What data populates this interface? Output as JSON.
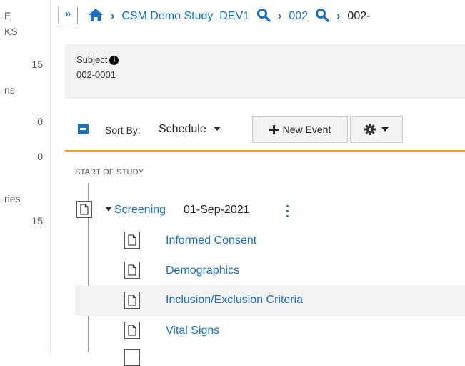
{
  "sidebar": {
    "items": [
      {
        "label": "E"
      },
      {
        "label": "KS"
      },
      {
        "label": "15"
      },
      {
        "label": "ns"
      },
      {
        "label": "0"
      },
      {
        "label": "0"
      },
      {
        "label": "ries"
      },
      {
        "label": "15"
      }
    ]
  },
  "header": {
    "collapse_glyph": "»",
    "breadcrumb": {
      "study": "CSM Demo Study_DEV1",
      "site": "002",
      "subject_partial": "002-"
    }
  },
  "subject": {
    "label": "Subject",
    "info_glyph": "i",
    "value": "002-0001"
  },
  "toolbar": {
    "sort_label": "Sort By:",
    "sort_value": "Schedule",
    "new_event_label": "New Event"
  },
  "timeline": {
    "section_label": "START OF STUDY",
    "event": {
      "name": "Screening",
      "date": "01-Sep-2021"
    },
    "forms": [
      {
        "name": "Informed Consent"
      },
      {
        "name": "Demographics"
      },
      {
        "name": "Inclusion/Exclusion Criteria"
      },
      {
        "name": "Vital Signs"
      }
    ]
  },
  "colors": {
    "link": "#1d6fb8",
    "accent_rule": "#f39c2a",
    "highlight_row": "#f2f2f2"
  },
  "icons": [
    "home-icon",
    "chevron-right-icon",
    "search-icon",
    "info-icon",
    "minus-box-icon",
    "caret-down-icon",
    "plus-icon",
    "gear-icon",
    "document-icon",
    "kebab-menu-icon"
  ]
}
